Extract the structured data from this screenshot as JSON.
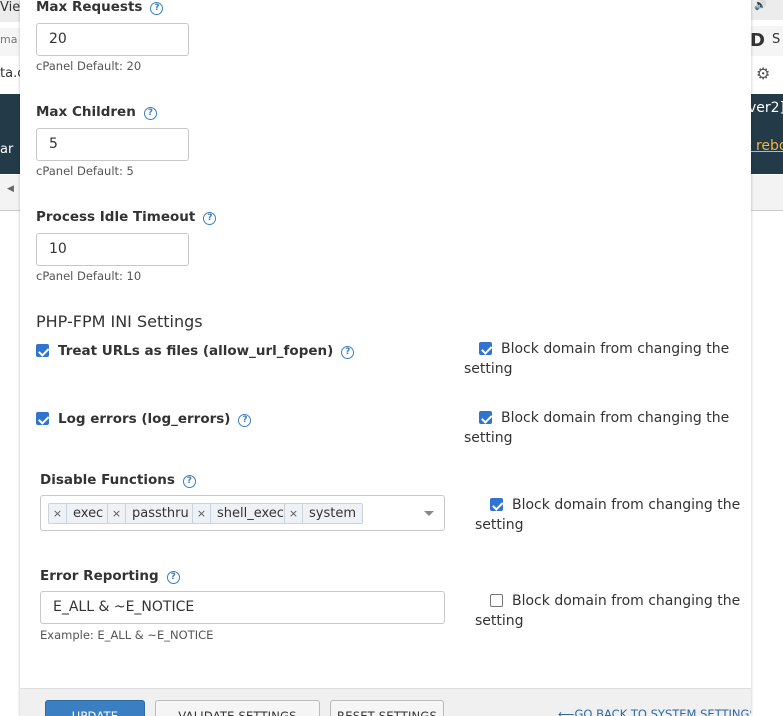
{
  "background": {
    "left_fragments": [
      "Vie",
      "ma",
      "ta.c",
      "ar"
    ],
    "right_fragments": [
      "D",
      "S",
      "ver2]",
      "t rebo"
    ]
  },
  "form": {
    "max_requests": {
      "label": "Max Requests",
      "help": "?",
      "value": "20",
      "hint": "cPanel Default: 20"
    },
    "max_children": {
      "label": "Max Children",
      "help": "?",
      "value": "5",
      "hint": "cPanel Default: 5"
    },
    "process_idle_timeout": {
      "label": "Process Idle Timeout",
      "help": "?",
      "value": "10",
      "hint": "cPanel Default: 10"
    },
    "ini_section_title": "PHP-FPM INI Settings",
    "allow_url_fopen": {
      "label": "Treat URLs as files (allow_url_fopen)",
      "help": "?",
      "checked": true,
      "block_checked": true,
      "block_line1": "Block domain from changing the",
      "block_line2": "setting"
    },
    "log_errors": {
      "label": "Log errors (log_errors)",
      "help": "?",
      "checked": true,
      "block_checked": true,
      "block_line1": "Block domain from changing the",
      "block_line2": "setting"
    },
    "disable_functions": {
      "label": "Disable Functions",
      "help": "?",
      "tags": [
        "exec",
        "passthru",
        "shell_exec",
        "system"
      ],
      "tag_remove": "×",
      "block_checked": true,
      "block_line1": "Block domain from changing the",
      "block_line2": "setting"
    },
    "error_reporting": {
      "label": "Error Reporting",
      "help": "?",
      "value": "E_ALL & ~E_NOTICE",
      "hint": "Example: E_ALL & ~E_NOTICE",
      "block_checked": false,
      "block_line1": "Block domain from changing the",
      "block_line2": "setting"
    }
  },
  "footer": {
    "update_label": "UPDATE",
    "validate_label": "VALIDATE SETTINGS",
    "reset_label": "RESET SETTINGS",
    "back_label": "GO BACK TO SYSTEM SETTINGS"
  },
  "colors": {
    "accent": "#3a7fc1",
    "checkbox": "#2f74d0",
    "link": "#2f6aa3"
  }
}
